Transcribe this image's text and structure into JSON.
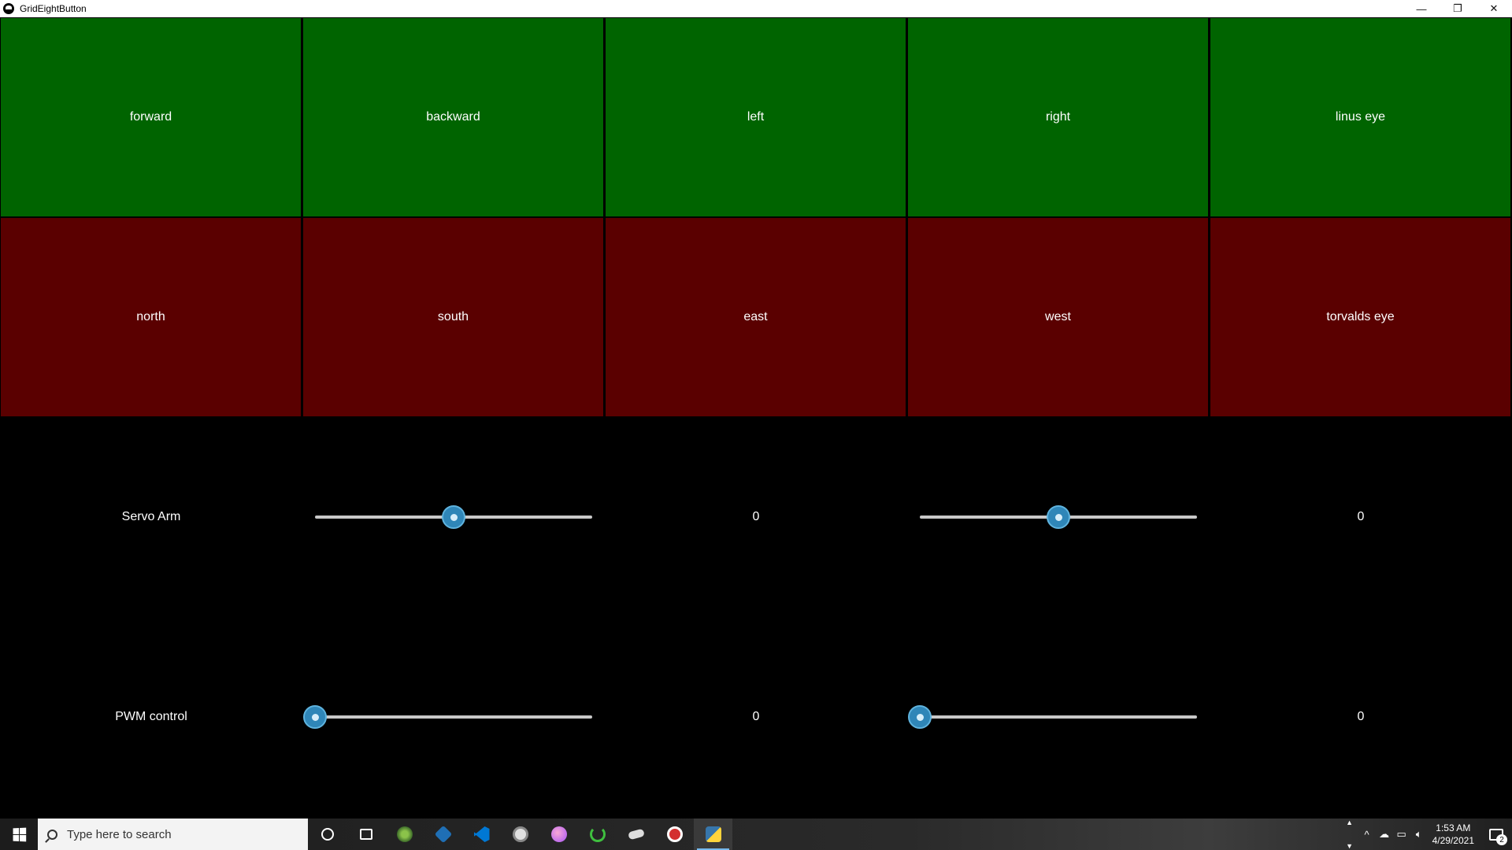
{
  "window": {
    "title": "GridEightButton",
    "minimize_glyph": "—",
    "restore_glyph": "❐",
    "close_glyph": "✕"
  },
  "grid": {
    "top_row": [
      "forward",
      "backward",
      "left",
      "right",
      "linus eye"
    ],
    "bottom_row": [
      "north",
      "south",
      "east",
      "west",
      "torvalds eye"
    ],
    "top_color": "#006400",
    "bottom_color": "#5a0000"
  },
  "controls": {
    "servo": {
      "label": "Servo Arm",
      "slider1_fraction": 0.5,
      "value1": "0",
      "slider2_fraction": 0.5,
      "value2": "0"
    },
    "pwm": {
      "label": "PWM control",
      "slider1_fraction": 0.0,
      "value1": "0",
      "slider2_fraction": 0.0,
      "value2": "0"
    }
  },
  "taskbar": {
    "search_placeholder": "Type here to search",
    "pinned_icons": [
      "cortana-icon",
      "task-view-icon",
      "android-studio-icon",
      "virtualbox-icon",
      "vscode-icon",
      "github-desktop-icon",
      "itunes-icon",
      "cycle-icon",
      "cloud-storage-icon",
      "app-red-icon",
      "python-icon"
    ],
    "time": "1:53 AM",
    "date": "4/29/2021",
    "notification_count": "2"
  }
}
